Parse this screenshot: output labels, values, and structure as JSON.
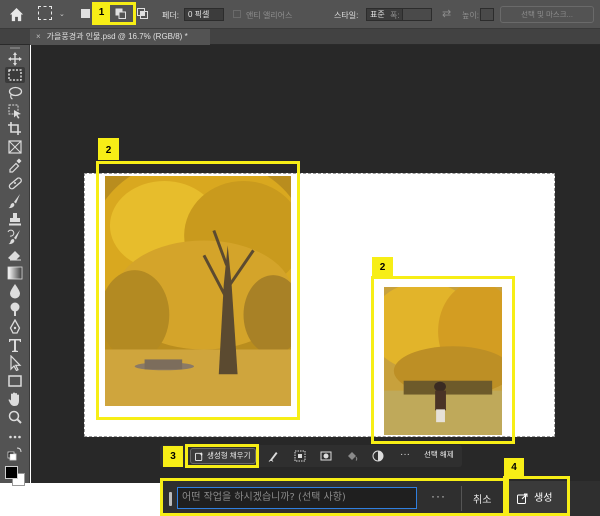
{
  "options_bar": {
    "feather_label": "페더:",
    "feather_value": "0 픽셀",
    "antialias_label": "앤티 앨리어스",
    "style_label": "스타일:",
    "style_value": "표준",
    "width_label": "폭:",
    "height_label": "높이:",
    "select_mask_label": "선택 및 마스크..."
  },
  "tab": {
    "close": "×",
    "title": "가을풍경과 인물.psd @ 16.7% (RGB/8) *"
  },
  "taskbar": {
    "generative_fill_label": "생성형 채우기",
    "more": "···",
    "deselect_label": "선택 해제"
  },
  "prompt_bar": {
    "placeholder": "어떤 작업을 하시겠습니까? (선택 사항)",
    "more": "···",
    "cancel_label": "취소",
    "generate_label": "생성"
  },
  "annotations": {
    "badge_1": "1",
    "badge_2a": "2",
    "badge_2b": "2",
    "badge_3": "3",
    "badge_4": "4"
  },
  "colors": {
    "highlight": "#f7ee16",
    "focus_ring": "#2f7fe0",
    "panel": "#535353",
    "canvas": "#282828"
  }
}
